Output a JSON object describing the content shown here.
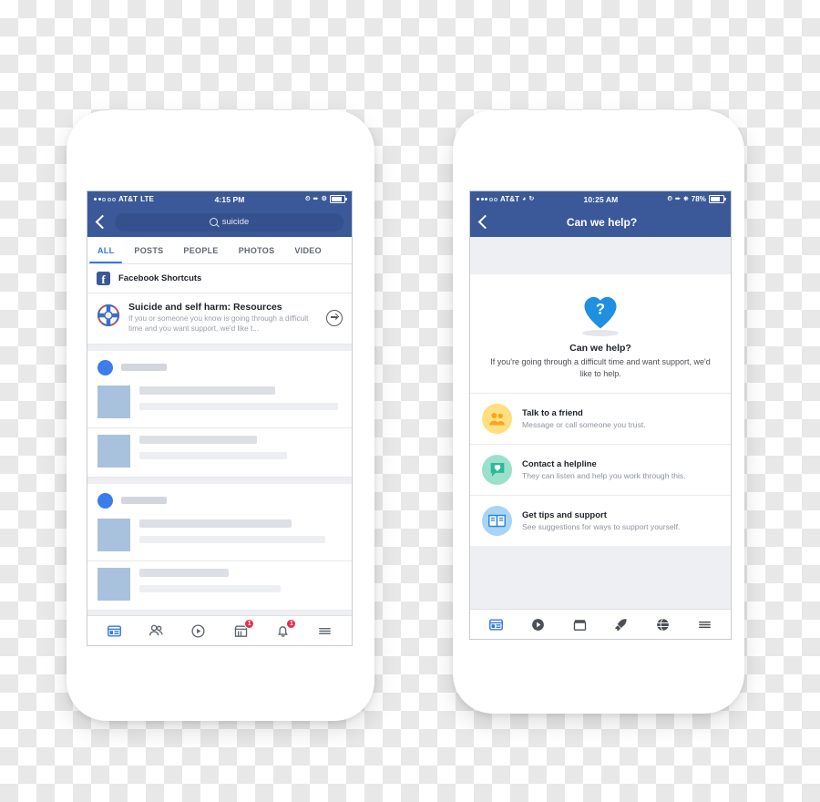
{
  "background": {
    "type": "transparency-checkerboard",
    "colors": [
      "#ffffff",
      "#e8e8e8"
    ]
  },
  "theme": {
    "facebook_blue": "#3b5998",
    "accent_blue": "#3578e5",
    "badge_red": "#f02849"
  },
  "phone_left": {
    "status_bar": {
      "carrier": "AT&T",
      "network": "LTE",
      "time": "4:15 PM",
      "battery_percent": ""
    },
    "nav": {
      "back_icon": "chevron-left-icon",
      "search_icon": "search-icon",
      "search_value": "suicide",
      "search_placeholder": "Search"
    },
    "tabs": [
      {
        "label": "ALL",
        "active": true
      },
      {
        "label": "POSTS",
        "active": false
      },
      {
        "label": "PEOPLE",
        "active": false
      },
      {
        "label": "PHOTOS",
        "active": false
      },
      {
        "label": "VIDEO",
        "active": false
      }
    ],
    "shortcuts_row": {
      "icon": "facebook-logo-icon",
      "label": "Facebook Shortcuts"
    },
    "resource_row": {
      "icon": "life-preserver-icon",
      "title": "Suicide and self harm: Resources",
      "subtitle": "If you or someone you know is going through a difficult time and you want support, we'd like t...",
      "arrow_icon": "arrow-right-circle-icon"
    },
    "feed_placeholder": {
      "groups": [
        {
          "items": 2
        },
        {
          "items": 2
        }
      ]
    },
    "tabbar": [
      {
        "icon": "news-feed-icon",
        "active": true,
        "badge": ""
      },
      {
        "icon": "friends-icon",
        "active": false,
        "badge": ""
      },
      {
        "icon": "video-play-icon",
        "active": false,
        "badge": ""
      },
      {
        "icon": "marketplace-store-icon",
        "active": false,
        "badge": "1"
      },
      {
        "icon": "notifications-bell-icon",
        "active": false,
        "badge": "1"
      },
      {
        "icon": "hamburger-menu-icon",
        "active": false,
        "badge": ""
      }
    ]
  },
  "phone_right": {
    "status_bar": {
      "carrier": "AT&T",
      "network": "wifi",
      "time": "10:25 AM",
      "battery_percent": "78%"
    },
    "nav": {
      "back_icon": "chevron-left-icon",
      "title": "Can we help?"
    },
    "hero": {
      "icon": "heart-question-icon",
      "title": "Can we help?",
      "subtitle": "If you're going through a difficult time and want support, we'd like to help."
    },
    "options": [
      {
        "icon": "two-people-icon",
        "icon_bg": "#ffdf7e",
        "icon_color": "#f5a623",
        "title": "Talk to a friend",
        "subtitle": "Message or call someone you trust."
      },
      {
        "icon": "chat-bubble-heart-icon",
        "icon_bg": "#9be0cb",
        "icon_color": "#2bb99a",
        "title": "Contact a helpline",
        "subtitle": "They can listen and help you work through this."
      },
      {
        "icon": "open-book-icon",
        "icon_bg": "#a9d4f5",
        "icon_color": "#2b87dd",
        "title": "Get tips and support",
        "subtitle": "See suggestions for ways to support yourself."
      }
    ],
    "tabbar": [
      {
        "icon": "news-feed-icon",
        "active": true
      },
      {
        "icon": "video-play-icon",
        "active": false
      },
      {
        "icon": "marketplace-store-icon",
        "active": false
      },
      {
        "icon": "rocket-icon",
        "active": false
      },
      {
        "icon": "globe-icon",
        "active": false
      },
      {
        "icon": "hamburger-menu-icon",
        "active": false
      }
    ]
  }
}
